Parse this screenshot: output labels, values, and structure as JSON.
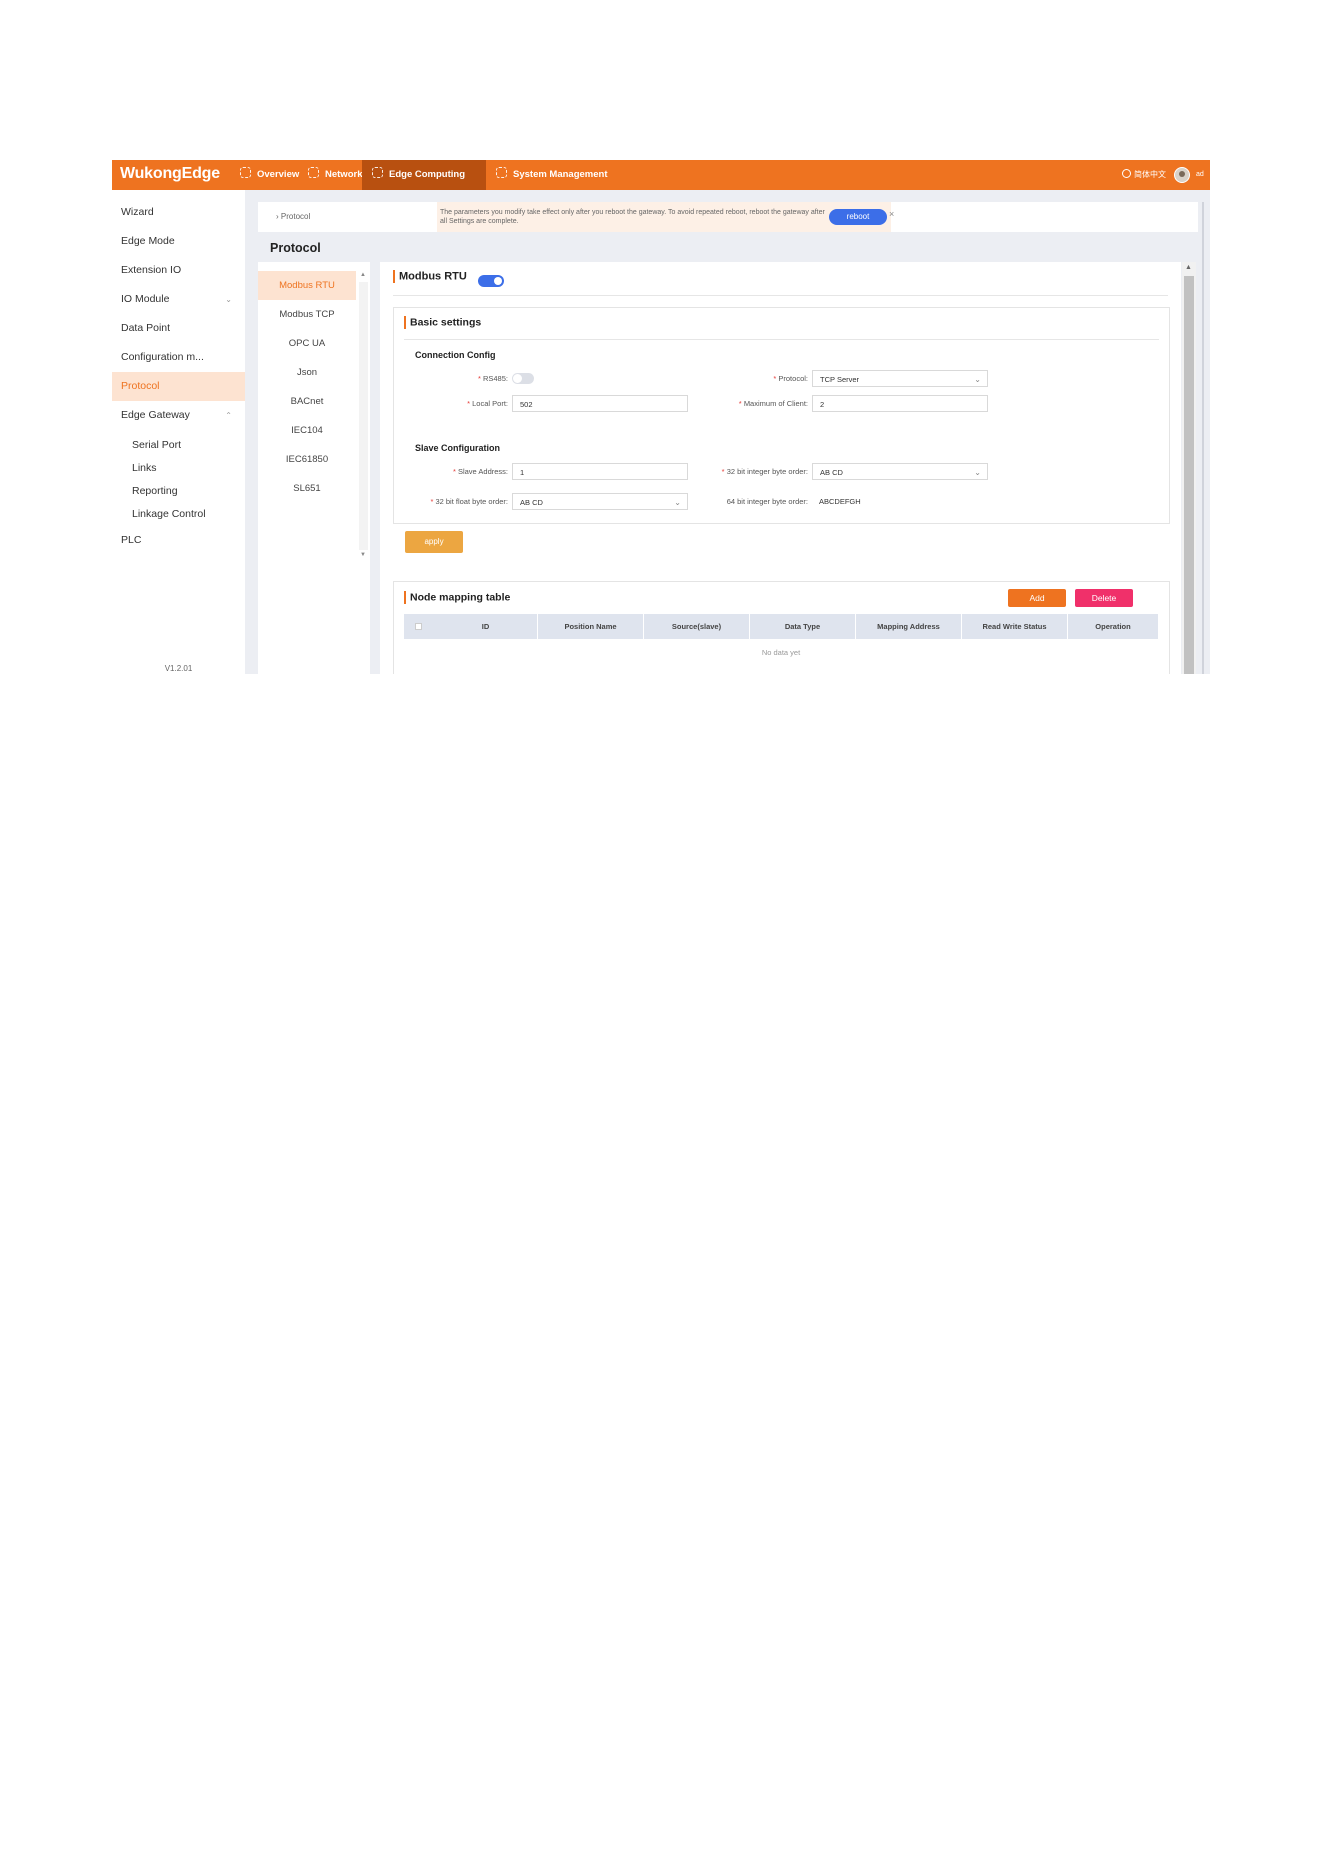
{
  "app": {
    "logo": "WukongEdge",
    "language": "简体中文",
    "username": "ad"
  },
  "nav": [
    {
      "label": "Overview",
      "active": false
    },
    {
      "label": "Network",
      "active": false
    },
    {
      "label": "Edge Computing",
      "active": true
    },
    {
      "label": "System Management",
      "active": false
    }
  ],
  "sidebar": {
    "items": [
      {
        "label": "Wizard"
      },
      {
        "label": "Edge Mode"
      },
      {
        "label": "Extension IO"
      },
      {
        "label": "IO Module"
      },
      {
        "label": "Data Point"
      },
      {
        "label": "Configuration m..."
      },
      {
        "label": "Protocol",
        "active": true
      },
      {
        "label": "Edge Gateway"
      }
    ],
    "sub_items": [
      {
        "label": "Serial Port"
      },
      {
        "label": "Links"
      },
      {
        "label": "Reporting"
      },
      {
        "label": "Linkage Control"
      }
    ],
    "plc": "PLC",
    "version": "V1.2.01"
  },
  "breadcrumb": {
    "current": "Protocol"
  },
  "notice": {
    "text": "The parameters you modify take effect only after you reboot the gateway. To avoid repeated reboot, reboot the gateway after all Settings are complete.",
    "reboot_label": "reboot",
    "close_symbol": "×"
  },
  "page_title": "Protocol",
  "protocols": [
    {
      "label": "Modbus RTU",
      "active": true
    },
    {
      "label": "Modbus TCP"
    },
    {
      "label": "OPC UA"
    },
    {
      "label": "Json"
    },
    {
      "label": "BACnet"
    },
    {
      "label": "IEC104"
    },
    {
      "label": "IEC61850"
    },
    {
      "label": "SL651"
    }
  ],
  "main": {
    "title": "Modbus RTU",
    "enabled": true,
    "basic_settings": {
      "title": "Basic settings",
      "connection_config": {
        "title": "Connection Config",
        "rs485_label": "RS485:",
        "rs485_enabled": false,
        "protocol_label": "Protocol:",
        "protocol_value": "TCP Server",
        "local_port_label": "Local Port:",
        "local_port_value": "502",
        "max_client_label": "Maximum of Client:",
        "max_client_value": "2"
      },
      "slave_config": {
        "title": "Slave Configuration",
        "slave_address_label": "Slave Address:",
        "slave_address_value": "1",
        "int32_order_label": "32 bit integer byte order:",
        "int32_order_value": "AB CD",
        "float32_order_label": "32 bit float byte order:",
        "float32_order_value": "AB CD",
        "int64_order_label": "64 bit integer byte order:",
        "int64_order_value": "ABCDEFGH"
      },
      "apply_label": "apply"
    },
    "node_mapping": {
      "title": "Node mapping table",
      "add_label": "Add",
      "delete_label": "Delete",
      "columns": [
        "ID",
        "Position Name",
        "Source(slave)",
        "Data Type",
        "Mapping Address",
        "Read Write Status",
        "Operation"
      ],
      "empty_text": "No data yet"
    }
  },
  "colors": {
    "brand": "#ee7320",
    "nav_active": "#b85010",
    "accent_blue": "#3c6ee8",
    "delete": "#f0306a",
    "apply": "#eca641"
  }
}
